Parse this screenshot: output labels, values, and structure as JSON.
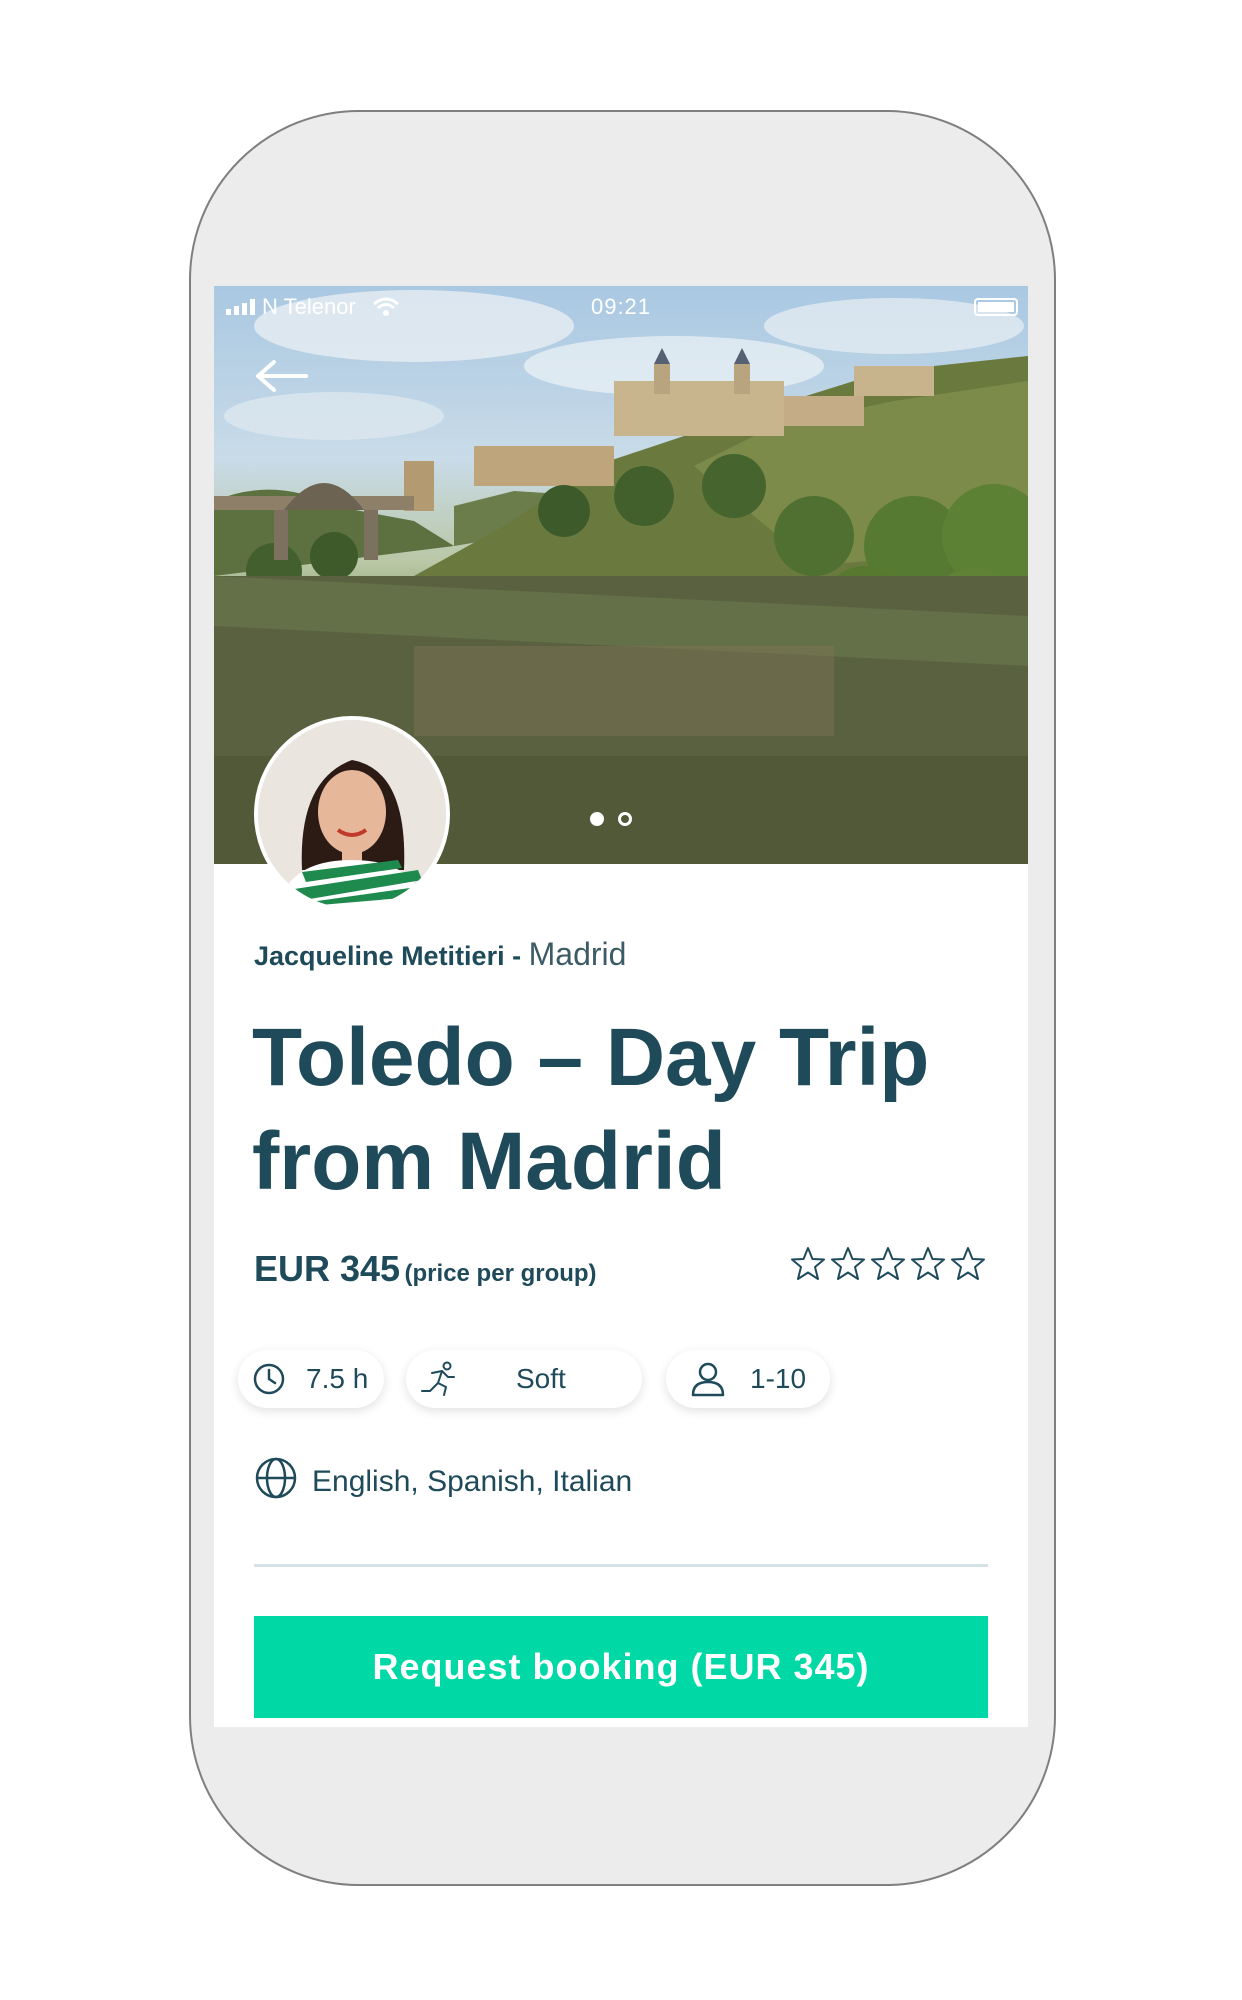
{
  "status_bar": {
    "carrier": "N Telenor",
    "time": "09:21"
  },
  "hero": {
    "slide_count": 2,
    "active_slide": 1
  },
  "host": {
    "name": "Jacqueline Metitieri",
    "separator": "-",
    "city": "Madrid"
  },
  "tour": {
    "title": "Toledo – Day Trip from Madrid",
    "price": "EUR 345",
    "price_note": "(price per group)",
    "rating_stars": 5,
    "rating_filled": 0
  },
  "chips": {
    "duration": "7.5 h",
    "activity_level": "Soft",
    "group_size": "1-10"
  },
  "languages": "English, Spanish, Italian",
  "cta": {
    "label": "Request booking (EUR 345)"
  },
  "colors": {
    "primary_text": "#1f4a5a",
    "cta_background": "#00d9a6",
    "divider": "#d5e3e8"
  },
  "icons": {
    "back": "arrow-left-icon",
    "duration": "clock-icon",
    "activity": "running-person-icon",
    "group": "person-icon",
    "languages": "globe-icon",
    "rating": "star-outline-icon"
  }
}
